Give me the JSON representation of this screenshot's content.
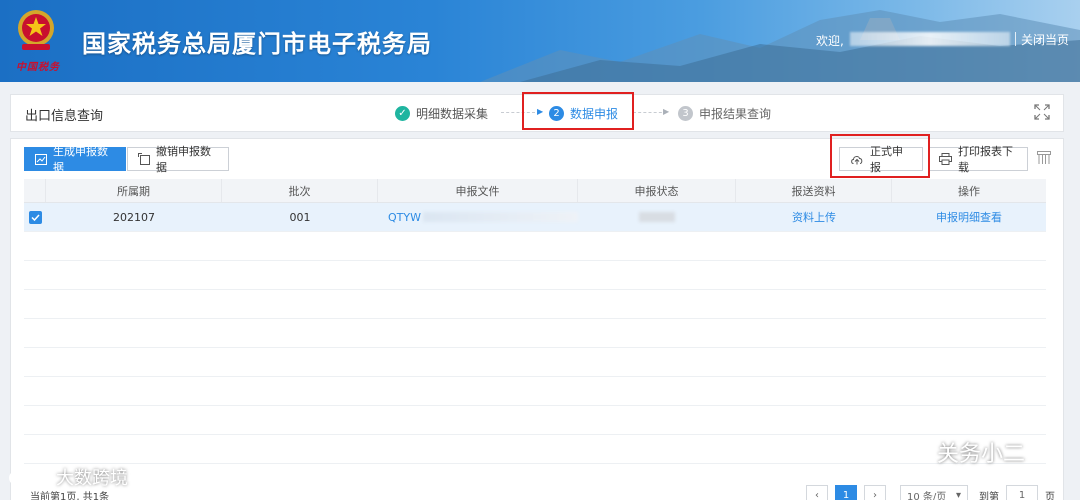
{
  "header": {
    "site_title": "国家税务总局厦门市电子税务局",
    "brand_sub": "中国税务",
    "welcome": "欢迎,",
    "close_page": "关闭当页"
  },
  "breadcrumb": {
    "page_name": "出口信息查询"
  },
  "steps": [
    {
      "num": "✓",
      "label": "明细数据采集",
      "state": "done"
    },
    {
      "num": "2",
      "label": "数据申报",
      "state": "active"
    },
    {
      "num": "3",
      "label": "申报结果查询",
      "state": "pending"
    }
  ],
  "toolbar": {
    "generate_label": "生成申报数据",
    "cancel_label": "撤销申报数据",
    "formal_label": "正式申报",
    "print_label": "打印报表下载"
  },
  "table": {
    "columns": [
      "所属期",
      "批次",
      "申报文件",
      "申报状态",
      "报送资料",
      "操作"
    ],
    "rows": [
      {
        "period": "202107",
        "batch": "001",
        "file_prefix": "QTYW",
        "upload_link": "资料上传",
        "view_link": "申报明细查看",
        "selected": true
      }
    ]
  },
  "pagination": {
    "summary": "当前第1页, 共1条",
    "current_page": "1",
    "page_size": "10 条/页",
    "goto_label": "到第",
    "goto_value": "1",
    "page_suffix": "页"
  },
  "watermarks": {
    "right": "关务小二",
    "left": "大数跨境"
  },
  "colors": {
    "accent": "#2d8be4",
    "done_step": "#1fb5a0",
    "highlight": "#e02020"
  }
}
